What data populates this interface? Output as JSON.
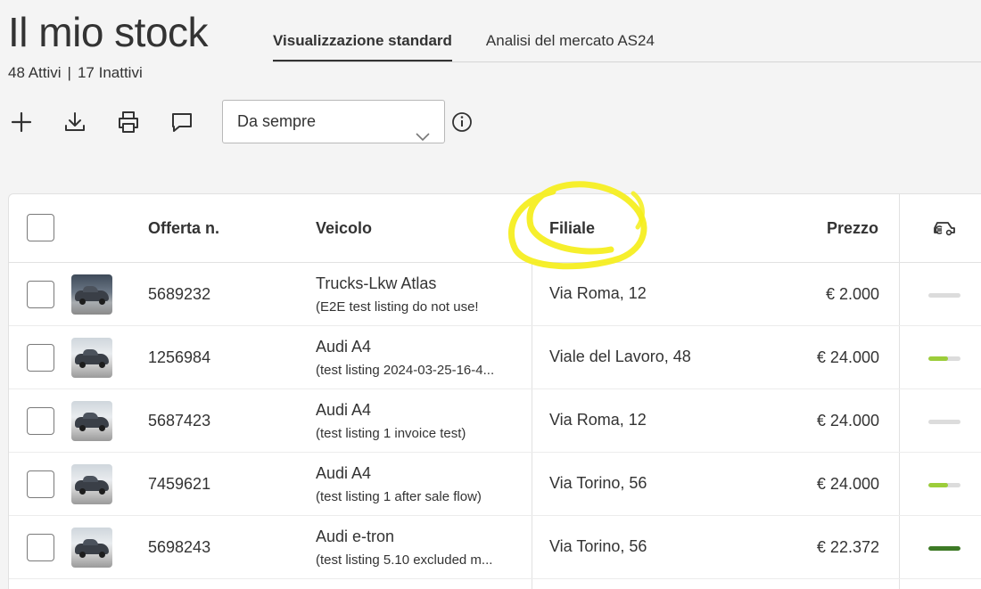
{
  "page": {
    "title": "Il mio stock",
    "tabs": [
      {
        "label": "Visualizzazione standard",
        "active": true
      },
      {
        "label": "Analisi del mercato AS24",
        "active": false
      }
    ],
    "stats": {
      "active": "48 Attivi",
      "separator": "|",
      "inactive": "17 Inattivi"
    }
  },
  "toolbar": {
    "icons": [
      "plus-icon",
      "download-icon",
      "print-icon",
      "comment-icon"
    ],
    "date_filter": {
      "value": "Da sempre"
    },
    "info_icon": "info-icon"
  },
  "table": {
    "headers": {
      "offer": "Offerta n.",
      "vehicle": "Veicolo",
      "branch": "Filiale",
      "price": "Prezzo",
      "quality_icon": "car-euro-icon"
    },
    "rows": [
      {
        "offer": "5689232",
        "vehicle": "Trucks-Lkw Atlas",
        "description": "(E2E test listing do not use!",
        "branch": "Via Roma, 12",
        "price": "€ 2.000",
        "quality": 0.0,
        "quality_color": "#dcdcdc",
        "thumb": "dark"
      },
      {
        "offer": "1256984",
        "vehicle": "Audi A4",
        "description": "(test listing 2024-03-25-16-4...",
        "branch": "Viale del Lavoro, 48",
        "price": "€ 24.000",
        "quality": 0.6,
        "quality_color": "#9ccd3a",
        "thumb": "light"
      },
      {
        "offer": "5687423",
        "vehicle": "Audi A4",
        "description": "(test listing 1 invoice test)",
        "branch": "Via Roma, 12",
        "price": "€ 24.000",
        "quality": 0.0,
        "quality_color": "#dcdcdc",
        "thumb": "light"
      },
      {
        "offer": "7459621",
        "vehicle": "Audi A4",
        "description": "(test listing 1 after sale flow)",
        "branch": "Via Torino, 56",
        "price": "€ 24.000",
        "quality": 0.6,
        "quality_color": "#9ccd3a",
        "thumb": "light"
      },
      {
        "offer": "5698243",
        "vehicle": "Audi e-tron",
        "description": "(test listing 5.10 excluded m...",
        "branch": "Via Torino, 56",
        "price": "€ 22.372",
        "quality": 1.0,
        "quality_color": "#3d7a26",
        "thumb": "light"
      }
    ]
  },
  "annotation": {
    "color": "#f5ee1a"
  }
}
